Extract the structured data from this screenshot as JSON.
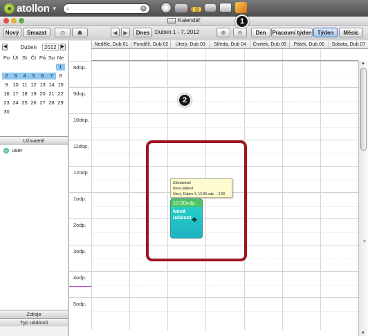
{
  "topbar": {
    "logo": "atollon",
    "search": {
      "value": "",
      "placeholder": ""
    }
  },
  "window": {
    "title": "Kalendář"
  },
  "toolbar": {
    "new_label": "Nový",
    "delete_label": "Smazat",
    "today_label": "Dnes",
    "range_label": "Duben 1 - 7, 2012",
    "views": [
      "Den",
      "Pracovní týden",
      "Týden",
      "Měsíc"
    ],
    "selected_view": "Týden"
  },
  "minical": {
    "month": "Duben",
    "year": "2012",
    "weekdays": [
      "Po",
      "Út",
      "St",
      "Čt",
      "Pá",
      "So",
      "Ne"
    ],
    "days": [
      "",
      "",
      "",
      "",
      "",
      "",
      "1",
      "2",
      "3",
      "4",
      "5",
      "6",
      "7",
      "8",
      "9",
      "10",
      "11",
      "12",
      "13",
      "14",
      "15",
      "16",
      "17",
      "18",
      "19",
      "20",
      "21",
      "22",
      "23",
      "24",
      "25",
      "26",
      "27",
      "28",
      "29",
      "30",
      "",
      "",
      "",
      "",
      "",
      ""
    ]
  },
  "users_panel": {
    "header": "Uživatelé",
    "users": [
      "user"
    ]
  },
  "bottom_tabs": [
    "Zdroje",
    "Typ události"
  ],
  "calendar": {
    "day_headers": [
      "Neděle, Dub 01",
      "Pondělí, Dub 02",
      "Úterý, Dub 03",
      "Středa, Dub 04",
      "Čtvrtek, Dub 05",
      "Pátek, Dub 06",
      "Sobota, Dub 07"
    ],
    "hours": [
      "8dop.",
      "9dop.",
      "10dop.",
      "11dop.",
      "12odp.",
      "1odp.",
      "2odp.",
      "3odp.",
      "4odp.",
      "5odp."
    ],
    "event": {
      "time": "12:30odp.",
      "title": "Nová událost"
    },
    "tooltip": {
      "line1": "Uživatelnull",
      "line2": "Nová událost",
      "line3": "Úterý, Duben 3, 12:30 odp. – 2:00 odp."
    }
  },
  "markers": [
    "1",
    "2"
  ],
  "colors": {
    "event_fill": "#1fc0c8",
    "event_header": "#4cc45f",
    "highlight": "#9e1520",
    "minical_highlight": "#8ec8f2",
    "now_line": "#b24cc7"
  }
}
